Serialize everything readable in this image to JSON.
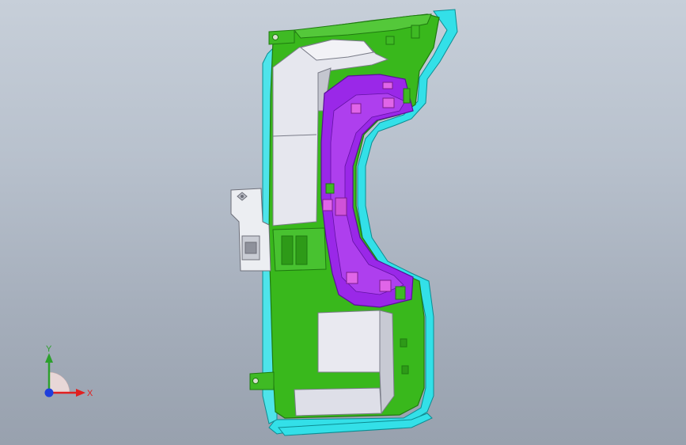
{
  "triad": {
    "x_label": "X",
    "y_label": "Y",
    "x_color": "#e02020",
    "y_color": "#2ca02c",
    "z_color": "#1f3fdc"
  },
  "palette": {
    "background_top": "#c7cfd9",
    "background_bottom": "#98a1ae",
    "green": "#39b81c",
    "green_dark": "#1f7a10",
    "purple": "#9a28e8",
    "purple_dark": "#5a0f99",
    "magenta": "#e065e8",
    "cyan": "#33e0e8",
    "white_part": "#e6e7ee",
    "grey_part": "#cfd2dd"
  },
  "model": {
    "icon": "cad-part-model"
  }
}
